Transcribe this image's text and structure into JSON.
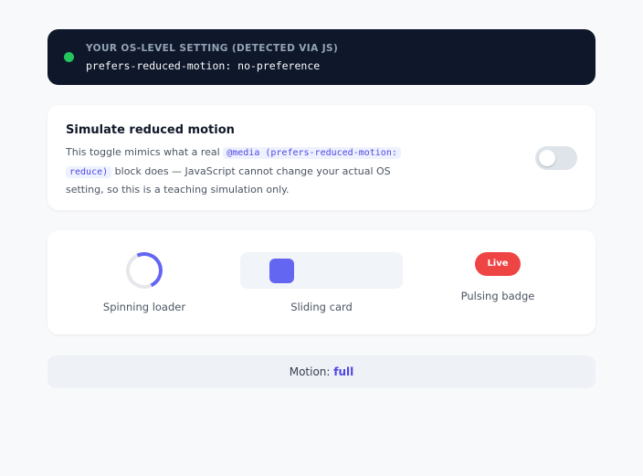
{
  "os_setting": {
    "kicker": "YOUR OS-LEVEL SETTING (DETECTED VIA JS)",
    "value": "prefers-reduced-motion: no-preference",
    "indicator_color": "#22c55e"
  },
  "simulate": {
    "title": "Simulate reduced motion",
    "desc_part1": "This toggle mimics what a real ",
    "code_1": "@media (prefers-reduced-motion:",
    "code_2": "reduce)",
    "desc_part2": " block does — JavaScript cannot change your actual OS setting, so this is a teaching simulation only.",
    "toggle_on": false
  },
  "demos": {
    "spinner_label": "Spinning loader",
    "slide_label": "Sliding card",
    "badge_text": "Live",
    "badge_label": "Pulsing badge",
    "accent_color": "#6366f1",
    "badge_color": "#ef4444"
  },
  "status": {
    "label": "Motion:",
    "value": "full"
  }
}
